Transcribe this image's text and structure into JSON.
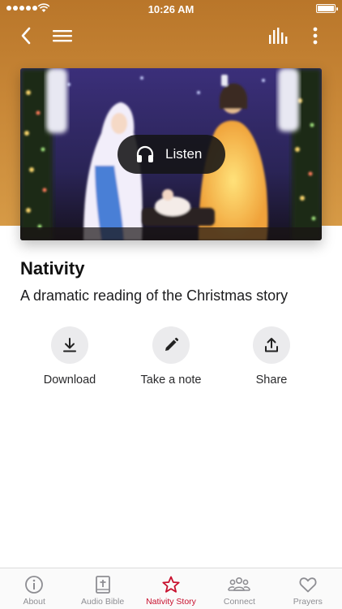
{
  "status_bar": {
    "time": "10:26 AM"
  },
  "hero": {
    "listen_label": "Listen"
  },
  "content": {
    "title": "Nativity",
    "subtitle": "A dramatic reading of the Christmas story"
  },
  "actions": [
    {
      "label": "Download",
      "icon": "download-icon"
    },
    {
      "label": "Take a note",
      "icon": "pencil-icon"
    },
    {
      "label": "Share",
      "icon": "share-icon"
    }
  ],
  "tabs": [
    {
      "label": "About",
      "icon": "info-icon",
      "active": false
    },
    {
      "label": "Audio Bible",
      "icon": "bible-icon",
      "active": false
    },
    {
      "label": "Nativity Story",
      "icon": "star-icon",
      "active": true
    },
    {
      "label": "Connect",
      "icon": "people-icon",
      "active": false
    },
    {
      "label": "Prayers",
      "icon": "heart-icon",
      "active": false
    }
  ],
  "colors": {
    "header": "#c88737",
    "active_tab": "#c8102e",
    "inactive_tab": "#8e8e93",
    "action_circle": "#ebebed"
  }
}
